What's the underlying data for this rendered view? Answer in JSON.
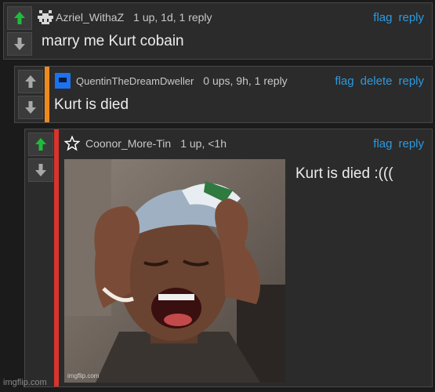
{
  "colors": {
    "upvote_active": "#1dbd3a",
    "vote_inactive": "#a8a8a8",
    "link": "#2c9adf",
    "stripe_orange": "#ee8a1b",
    "stripe_red": "#d9342b",
    "avatar_blue": "#1d72ee"
  },
  "comments": [
    {
      "username": "Azriel_WithaZ",
      "meta": "1 up, 1d, 1 reply",
      "actions": [
        "flag",
        "reply"
      ],
      "text": "marry me Kurt cobain",
      "upvoted": true,
      "avatar_icon": "pixel-mask-icon"
    },
    {
      "username": "QuentinTheDreamDweller",
      "meta": "0 ups, 9h, 1 reply",
      "actions": [
        "flag",
        "delete",
        "reply"
      ],
      "text": "Kurt is died",
      "upvoted": false,
      "avatar_icon": "blue-square-icon"
    },
    {
      "username": "Coonor_More-Tin",
      "meta": "1 up, <1h",
      "actions": [
        "flag",
        "reply"
      ],
      "text": "Kurt is died :(((",
      "upvoted": true,
      "avatar_icon": "star-outline-icon",
      "image_watermark": "imgflip.com"
    }
  ],
  "footer_watermark": "imgflip.com"
}
